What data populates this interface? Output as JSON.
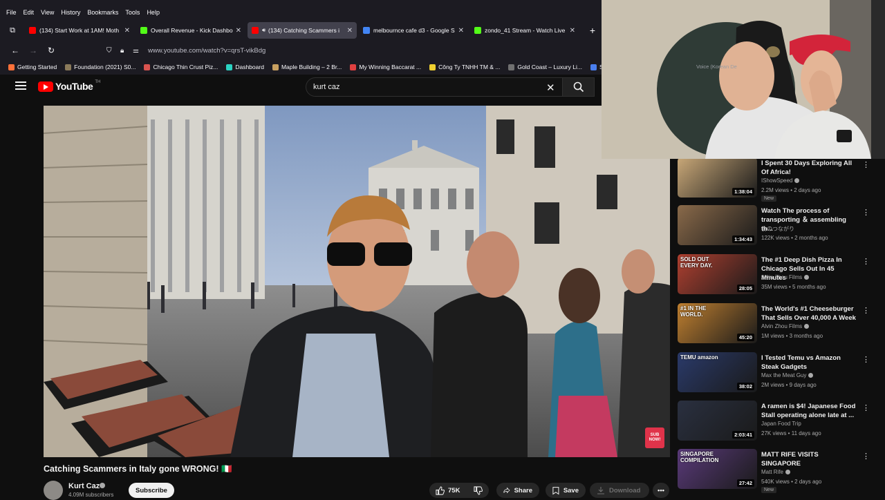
{
  "browser": {
    "menu": [
      "File",
      "Edit",
      "View",
      "History",
      "Bookmarks",
      "Tools",
      "Help"
    ],
    "tabs": [
      {
        "title": "(134) Start Work at 1AM! Moth",
        "favicon_color": "#ff0000",
        "active": false,
        "audio": false
      },
      {
        "title": "Overall Revenue - Kick Dashbo",
        "favicon_color": "#53fc18",
        "active": false,
        "audio": false
      },
      {
        "title": "(134) Catching Scammers i",
        "favicon_color": "#ff0000",
        "active": true,
        "audio": true
      },
      {
        "title": "melbournce cafe d3 - Google S",
        "favicon_color": "#4285f4",
        "active": false,
        "audio": false
      },
      {
        "title": "zondo_41 Stream - Watch Live",
        "favicon_color": "#53fc18",
        "active": false,
        "audio": false
      }
    ],
    "url": "www.youtube.com/watch?v=qrsT-vikBdg",
    "bookmarks": [
      {
        "label": "Getting Started",
        "color": "#ff7139"
      },
      {
        "label": "Foundation (2021) S0...",
        "color": "#8a7a5a"
      },
      {
        "label": "Chicago Thin Crust Piz...",
        "color": "#d9534f"
      },
      {
        "label": "Dashboard",
        "color": "#2bd2c2"
      },
      {
        "label": "Maple Building – 2 Br...",
        "color": "#c8a060"
      },
      {
        "label": "My Winning Baccarat ...",
        "color": "#e04040"
      },
      {
        "label": "Công Ty TNHH TM & ...",
        "color": "#f0d030"
      },
      {
        "label": "Gold Coast – Luxury Li...",
        "color": "#707070"
      },
      {
        "label": "Sign in · Dre",
        "color": "#4a7ff0"
      }
    ]
  },
  "youtube": {
    "logo_text": "YouTube",
    "logo_sup": "TH",
    "search_value": "kurt caz",
    "video": {
      "title": "Catching Scammers in Italy gone WRONG! 🇮🇹",
      "channel": "Kurt Caz",
      "subscribers": "4.09M subscribers",
      "subscribe_label": "Subscribe",
      "likes": "75K",
      "share_label": "Share",
      "save_label": "Save",
      "download_label": "Download",
      "overlay_sub": "SUB NOW!"
    },
    "recommendations": [
      {
        "title": "I Spent 30 Days Exploring All Of Africa!",
        "channel": "IShowSpeed",
        "verified": true,
        "meta": "2.2M views • 2 days ago",
        "badge": "New",
        "duration": "1:38:04",
        "thumb_color": "#c9a878"
      },
      {
        "title": "Watch The process of transporting ＆ assembling th...",
        "channel": "食のつながり",
        "verified": false,
        "meta": "122K views • 2 months ago",
        "badge": "",
        "duration": "1:34:43",
        "thumb_color": "#8a6a4a"
      },
      {
        "title": "The #1 Deep Dish Pizza In Chicago Sells Out In 45 Minutes",
        "channel": "Alvin Zhou Films",
        "verified": true,
        "meta": "35M views • 5 months ago",
        "badge": "",
        "duration": "28:05",
        "thumb_color": "#b04030",
        "thumb_text": "SOLD OUT EVERY DAY."
      },
      {
        "title": "The World's #1 Cheeseburger That Sells Over 40,000 A Week",
        "channel": "Alvin Zhou Films",
        "verified": true,
        "meta": "1M views • 3 months ago",
        "badge": "",
        "duration": "45:20",
        "thumb_color": "#c08030",
        "thumb_text": "#1 IN THE WORLD."
      },
      {
        "title": "I Tested Temu vs Amazon Steak Gadgets",
        "channel": "Max the Meat Guy",
        "verified": true,
        "meta": "2M views • 9 days ago",
        "badge": "",
        "duration": "38:02",
        "thumb_color": "#2a3a6a",
        "thumb_text": "TEMU amazon"
      },
      {
        "title": "A ramen is $4! Japanese Food Stall operating alone late at ...",
        "channel": "Japan Food Trip",
        "verified": false,
        "meta": "27K views • 11 days ago",
        "badge": "",
        "duration": "2:03:41",
        "thumb_color": "#2a3040"
      },
      {
        "title": "MATT RIFE VISITS SINGAPORE",
        "channel": "Matt Rife",
        "verified": true,
        "meta": "540K views • 2 days ago",
        "badge": "New",
        "duration": "27:42",
        "thumb_color": "#5a3a7a",
        "thumb_text": "SINGAPORE COMPILATION"
      }
    ]
  },
  "webcam": {
    "overlay_text": "Voice (Korean De"
  }
}
